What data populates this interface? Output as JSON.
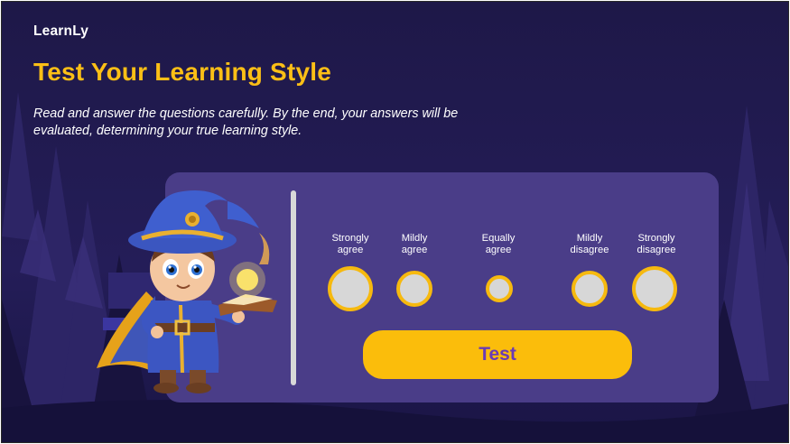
{
  "app": {
    "brand": "LearnLy"
  },
  "header": {
    "title": "Test Your Learning Style",
    "subtitle": "Read and answer the questions carefully. By the end, your answers will be evaluated, determining your true learning style."
  },
  "quiz": {
    "options": [
      {
        "label": "Strongly\nagree"
      },
      {
        "label": "Mildly\nagree"
      },
      {
        "label": "Equally\nagree"
      },
      {
        "label": "Mildly\ndisagree"
      },
      {
        "label": "Strongly\ndisagree"
      }
    ],
    "submit_label": "Test"
  },
  "colors": {
    "background": "#1f1a4f",
    "card": "#4a3d88",
    "accent": "#fbbf16",
    "button_text": "#6a3bb5"
  },
  "icons": {
    "mascot": "wizard-mascot-icon",
    "book": "glowing-book-icon"
  }
}
